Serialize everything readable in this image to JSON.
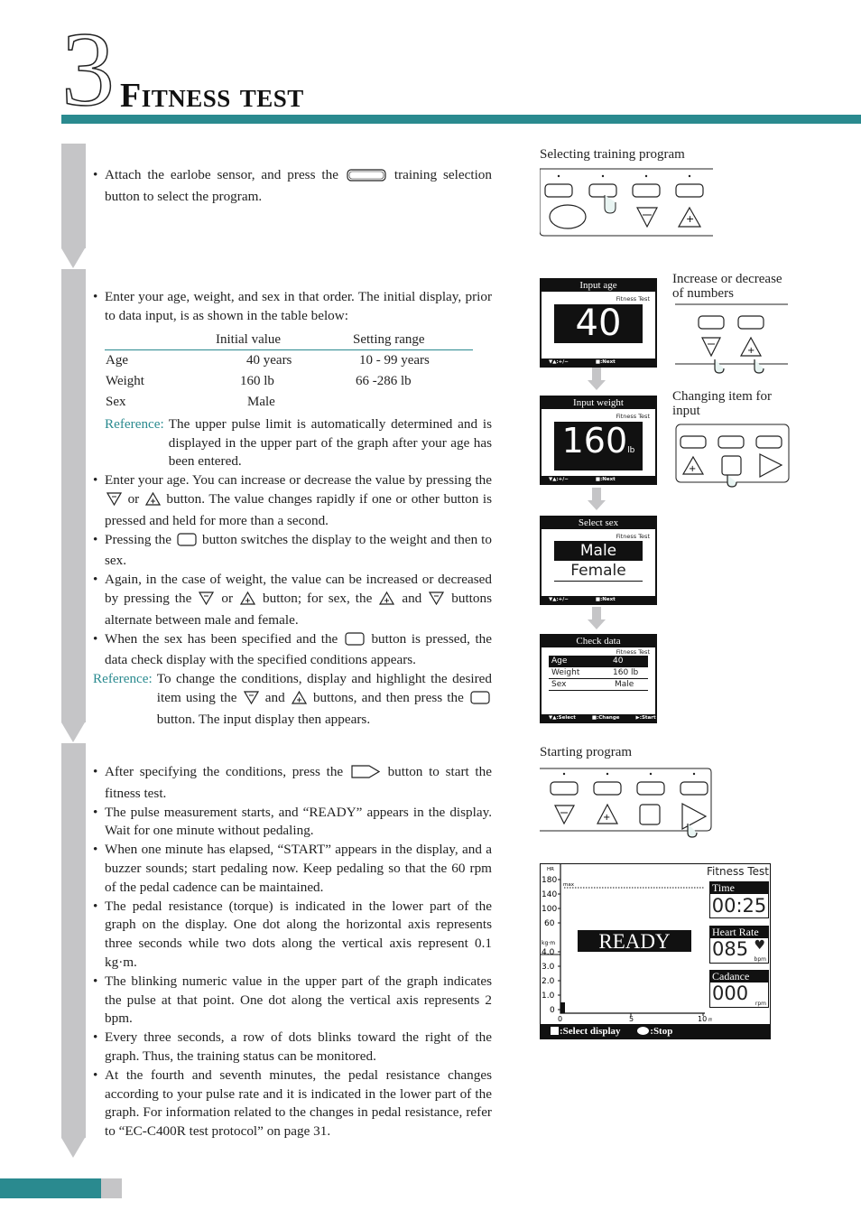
{
  "header": {
    "chapter_number": "3",
    "title": "Fitness test"
  },
  "colors": {
    "accent": "#2a8a8f",
    "sidebar": "#c5c5c7"
  },
  "section1": {
    "bullets": [
      [
        {
          "t": "Attach the earlobe sensor, and press the "
        },
        {
          "icon": "wide-button"
        },
        {
          "t": " training selection button to select the program."
        }
      ]
    ]
  },
  "section2": {
    "intro": [
      {
        "t": "Enter your age, weight, and sex in that order. The initial display, prior to data input, is as shown in the table below:"
      }
    ],
    "table": {
      "headers": [
        "",
        "Initial value",
        "Setting range"
      ],
      "rows": [
        [
          "Age",
          "40  years",
          "10 - 99  years"
        ],
        [
          "Weight",
          "160 lb",
          "66 -286 lb"
        ],
        [
          "Sex",
          "Male",
          ""
        ]
      ]
    },
    "reference1": {
      "label": "Reference:",
      "text": "The upper pulse limit is automatically determined and is displayed in the upper part of the graph after your age has been entered."
    },
    "bullets": [
      [
        {
          "t": "Enter your age. You can increase or decrease the value by pressing the "
        },
        {
          "icon": "minus-button"
        },
        {
          "t": " or "
        },
        {
          "icon": "plus-button"
        },
        {
          "t": " button. The value changes rapidly if one or other button is pressed and held for more than a second."
        }
      ],
      [
        {
          "t": "Pressing the "
        },
        {
          "icon": "square-button"
        },
        {
          "t": " button switches the display to the weight and then to sex."
        }
      ],
      [
        {
          "t": "Again, in the case of weight, the value can be increased or decreased by pressing the "
        },
        {
          "icon": "minus-button"
        },
        {
          "t": " or "
        },
        {
          "icon": "plus-button"
        },
        {
          "t": " button; for sex, the "
        },
        {
          "icon": "plus-button"
        },
        {
          "t": " and "
        },
        {
          "icon": "minus-button"
        },
        {
          "t": " buttons alternate between male and female."
        }
      ],
      [
        {
          "t": "When the sex has been specified and the "
        },
        {
          "icon": "square-button"
        },
        {
          "t": " button is pressed, the data check display with the specified conditions appears."
        }
      ]
    ],
    "reference2": {
      "label": "Reference:",
      "parts": [
        {
          "t": "To change the conditions, display and highlight the desired item using the "
        },
        {
          "icon": "minus-button"
        },
        {
          "t": " and "
        },
        {
          "icon": "plus-button"
        },
        {
          "t": " buttons, and then press the "
        },
        {
          "icon": "square-button"
        },
        {
          "t": " button. The input display then appears."
        }
      ]
    }
  },
  "section3": {
    "bullets": [
      [
        {
          "t": "After specifying the conditions, press the "
        },
        {
          "icon": "start-button"
        },
        {
          "t": " button to start the fitness test."
        }
      ],
      [
        {
          "t": "The pulse measurement starts, and “READY” appears in the display. Wait for one minute without pedaling."
        }
      ],
      [
        {
          "t": "When one minute has elapsed, “START” appears in the display, and a buzzer sounds; start pedaling now. Keep pedaling so that the 60 rpm of the pedal cadence can be maintained."
        }
      ],
      [
        {
          "t": "The pedal resistance (torque) is indicated in the lower part of the graph on the display. One dot along the horizontal axis represents three seconds while two dots along the vertical axis represent 0.1 kg·m."
        }
      ],
      [
        {
          "t": "The blinking numeric value in the upper part of the graph indicates the pulse at that point. One dot along the vertical axis represents 2 bpm."
        }
      ],
      [
        {
          "t": "Every three seconds, a row of dots blinks toward the right of the graph. Thus, the training status can be monitored."
        }
      ],
      [
        {
          "t": "At the fourth and seventh minutes, the pedal resistance changes according to your pulse rate and it is indicated in the lower part of the graph. For information related to the changes in pedal resistance, refer to “EC-C400R test protocol” on page 31."
        }
      ]
    ]
  },
  "figures": {
    "selecting_caption": "Selecting training program",
    "increase_caption": "Increase or decrease of numbers",
    "changing_caption": "Changing item for input",
    "starting_caption": "Starting program",
    "age_screen": {
      "title": "Input age",
      "subtitle": "Fitness Test",
      "value": "40",
      "footer_left": "▼▲:+/−",
      "footer_right": "■:Next"
    },
    "weight_screen": {
      "title": "Input weight",
      "subtitle": "Fitness Test",
      "value": "160",
      "unit": "lb",
      "footer_left": "▼▲:+/−",
      "footer_right": "■:Next"
    },
    "sex_screen": {
      "title": "Select sex",
      "subtitle": "Fitness Test",
      "male": "Male",
      "female": "Female",
      "footer_left": "▼▲:+/−",
      "footer_right": "■:Next"
    },
    "check_screen": {
      "title": "Check data",
      "subtitle": "Fitness Test",
      "rows": [
        [
          "Age",
          "40"
        ],
        [
          "Weight",
          "160 lb"
        ],
        [
          "Sex",
          "Male"
        ]
      ],
      "footer_left": "▼▲:Select",
      "footer_mid": "■:Change",
      "footer_right": "▶:Start"
    },
    "ready_screen": {
      "title": "Fitness Test",
      "hr_label": "HR",
      "hr_ticks": [
        "180",
        "140",
        "100",
        "60"
      ],
      "max_label": "max",
      "torque_label": "kg·m",
      "torque_ticks": [
        "4.0",
        "3.0",
        "2.0",
        "1.0",
        "0"
      ],
      "x_ticks": [
        "0",
        "5",
        "10"
      ],
      "x_unit": "min",
      "status": "READY",
      "time_label": "Time",
      "time_value": "00:25",
      "hr_box_label": "Heart Rate",
      "hr_value": "085",
      "hr_unit": "bpm",
      "cad_label": "Cadance",
      "cad_value": "000",
      "cad_unit": "rpm",
      "footer_select": ":Select display",
      "footer_stop": ":Stop"
    }
  }
}
